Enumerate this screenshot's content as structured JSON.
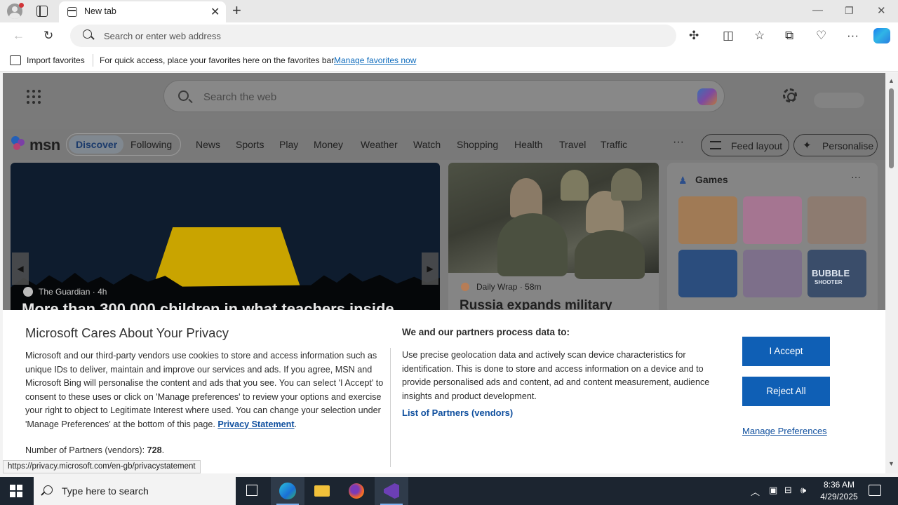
{
  "browser": {
    "tab_title": "New tab",
    "address_placeholder": "Search or enter web address",
    "favorites_bar": {
      "import_label": "Import favorites",
      "message": "For quick access, place your favorites here on the favorites bar.",
      "manage_link": "Manage favorites now"
    }
  },
  "msn": {
    "search_placeholder": "Search the web",
    "logo_text": "msn",
    "nav": {
      "discover": "Discover",
      "following": "Following",
      "items": [
        "News",
        "Sports",
        "Play",
        "Money",
        "Weather",
        "Watch",
        "Shopping",
        "Health",
        "Travel",
        "Traffic"
      ],
      "more": "···",
      "feed_layout": "Feed layout",
      "personalise": "Personalise"
    },
    "hero": {
      "source": "The Guardian",
      "age": "4h",
      "title": "More than 300,000 children in what teachers inside..."
    },
    "story2": {
      "source": "Daily Wrap",
      "age": "· 58m",
      "title": "Russia expands military"
    },
    "games": {
      "title": "Games",
      "more": "···",
      "bubble_label": "BUBBLE",
      "shooter_label": "SHOOTER"
    }
  },
  "consent": {
    "title": "Microsoft Cares About Your Privacy",
    "body": "Microsoft and our third-party vendors use cookies to store and access information such as unique IDs to deliver, maintain and improve our services and ads. If you agree, MSN and Microsoft Bing will personalise the content and ads that you see. You can select 'I Accept' to consent to these uses or click on 'Manage preferences' to review your options and exercise your right to object to Legitimate Interest where used.  You can change your selection under 'Manage Preferences' at the bottom of this page. ",
    "privacy_link": "Privacy Statement",
    "partners_count_label": "Number of Partners (vendors): ",
    "partners_count": "728",
    "process_heading": "We and our partners process data to:",
    "process_body": "Use precise geolocation data and actively scan device characteristics for identification. This is done to store and access information on a device and to provide personalised ads and content, ad and content measurement, audience insights and product development.",
    "partners_link": "List of Partners (vendors)",
    "accept": "I Accept",
    "reject": "Reject All",
    "manage": "Manage Preferences"
  },
  "status_url": "https://privacy.microsoft.com/en-gb/privacystatement",
  "taskbar": {
    "search_placeholder": "Type here to search",
    "time": "8:36 AM",
    "date": "4/29/2025"
  },
  "colors": {
    "accent": "#0f5fb5",
    "link": "#0f4f9e",
    "taskbar": "#1c2530"
  }
}
